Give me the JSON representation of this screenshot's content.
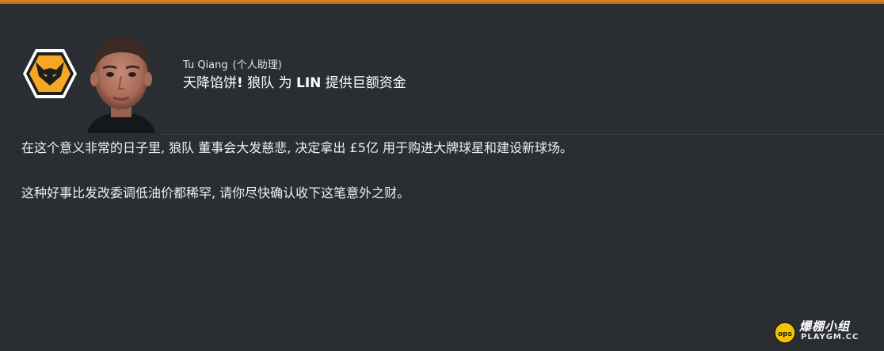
{
  "theme": {
    "accent": "#c8781f",
    "background": "#2a2e33",
    "badge_yellow": "#f5a623",
    "badge_dark": "#1e1e1e"
  },
  "message": {
    "sender_name": "Tu Qiang",
    "sender_role": "(个人助理)",
    "subject_prefix": "天降馅饼",
    "subject_bang": "!",
    "subject_club": "狼队",
    "subject_mid": "为",
    "subject_target": "LIN",
    "subject_suffix": "提供巨额资金",
    "paragraph_1": "在这个意义非常的日子里, 狼队 董事会大发慈悲, 决定拿出 £5亿 用于购进大牌球星和建设新球场。",
    "paragraph_2": "这种好事比发改委调低油价都稀罕, 请你尽快确认收下这笔意外之财。"
  },
  "icons": {
    "club_badge": "wolf-crest-icon",
    "sender_portrait": "person-portrait"
  },
  "watermark": {
    "text_cn": "爆棚小组",
    "text_en": "PLAYGM.CC",
    "logo_text": "ops"
  }
}
